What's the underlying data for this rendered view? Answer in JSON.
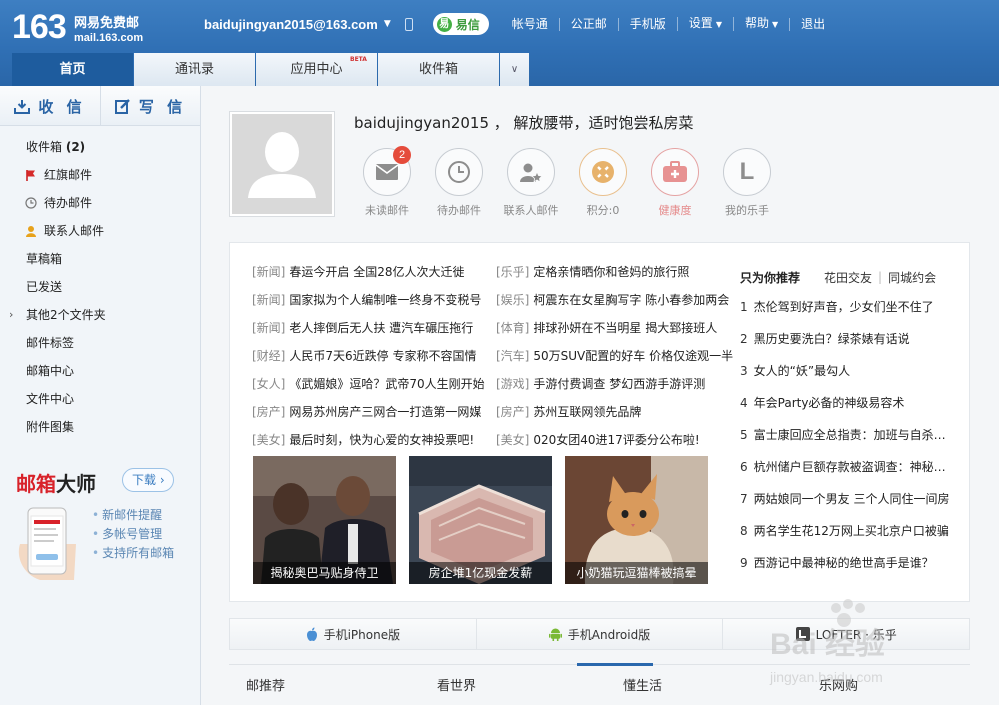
{
  "header": {
    "logo_number": "163",
    "logo_name": "网易免费邮",
    "logo_domain": "mail.163.com",
    "email": "baidujingyan2015@163.com",
    "yixin_label": "易信",
    "links": [
      "帐号通",
      "公正邮",
      "手机版",
      "设置",
      "帮助",
      "退出"
    ]
  },
  "tabs": [
    {
      "label": "首页",
      "active": true
    },
    {
      "label": "通讯录"
    },
    {
      "label": "应用中心",
      "badge": "BETA"
    },
    {
      "label": "收件箱"
    }
  ],
  "sidebar": {
    "receive_label": "收 信",
    "compose_label": "写 信",
    "items": [
      {
        "label": "收件箱",
        "count": "(2)"
      },
      {
        "label": "红旗邮件",
        "icon": "red-flag-icon"
      },
      {
        "label": "待办邮件",
        "icon": "clock-icon"
      },
      {
        "label": "联系人邮件",
        "icon": "contact-icon"
      },
      {
        "label": "草稿箱"
      },
      {
        "label": "已发送"
      },
      {
        "label": "其他2个文件夹",
        "expandable": true
      },
      {
        "label": "邮件标签"
      },
      {
        "label": "邮箱中心"
      },
      {
        "label": "文件中心"
      },
      {
        "label": "附件图集"
      }
    ],
    "promo": {
      "title_red": "邮箱",
      "title_dark": "大师",
      "download_label": "下载",
      "features": [
        "新邮件提醒",
        "多帐号管理",
        "支持所有邮箱"
      ]
    }
  },
  "profile": {
    "greeting": "baidujingyan2015 ，  解放腰带，适时饱尝私房菜",
    "stats": [
      {
        "label": "未读邮件",
        "badge": "2",
        "icon": "envelope-icon"
      },
      {
        "label": "待办邮件",
        "icon": "clock-icon"
      },
      {
        "label": "联系人邮件",
        "icon": "contact-star-icon"
      },
      {
        "label": "积分:0",
        "icon": "points-icon"
      },
      {
        "label": "健康度",
        "icon": "medkit-icon"
      },
      {
        "label": "我的乐手",
        "icon": "letter-l-icon",
        "glyph": "L"
      }
    ]
  },
  "news": [
    [
      {
        "cat": "[新闻]",
        "title": "春运今开启 全国28亿人次大迁徙"
      },
      {
        "cat": "[乐乎]",
        "title": "定格亲情晒你和爸妈的旅行照"
      }
    ],
    [
      {
        "cat": "[新闻]",
        "title": "国家拟为个人编制唯一终身不变税号"
      },
      {
        "cat": "[娱乐]",
        "title": "柯震东在女星胸写字 陈小春参加两会"
      }
    ],
    [
      {
        "cat": "[新闻]",
        "title": "老人摔倒后无人扶 遭汽车碾压拖行"
      },
      {
        "cat": "[体育]",
        "title": "排球孙妍在不当明星 揭大郅接班人"
      }
    ],
    [
      {
        "cat": "[财经]",
        "title": "人民币7天6近跌停 专家称不容国情"
      },
      {
        "cat": "[汽车]",
        "title": "50万SUV配置的好车 价格仅途观一半"
      }
    ],
    [
      {
        "cat": "[女人]",
        "title": "《武媚娘》逗哈？武帝70人生刚开始"
      },
      {
        "cat": "[游戏]",
        "title": "手游付费调查 梦幻西游手游评测"
      }
    ],
    [
      {
        "cat": "[房产]",
        "title": "网易苏州房产三网合一打造第一网媒"
      },
      {
        "cat": "[房产]",
        "title": "苏州互联网领先品牌"
      }
    ],
    [
      {
        "cat": "[美女]",
        "title": "最后时刻，快为心爱的女神投票吧!"
      },
      {
        "cat": "[美女]",
        "title": "020女团40进17评委分公布啦!"
      }
    ]
  ],
  "pictures": [
    {
      "caption": "揭秘奥巴马贴身侍卫"
    },
    {
      "caption": "房企堆1亿现金发薪"
    },
    {
      "caption": "小奶猫玩逗猫棒被搞晕"
    }
  ],
  "recommend": {
    "heading": "只为你推荐",
    "links": [
      "花田交友",
      "同城约会"
    ],
    "items": [
      {
        "n": "1",
        "title": "杰伦驾到好声音，少女们坐不住了"
      },
      {
        "n": "2",
        "title": "黑历史要洗白？绿茶婊有话说"
      },
      {
        "n": "3",
        "title": "女人的“妖”最勾人"
      },
      {
        "n": "4",
        "title": "年会Party必备的神级易容术"
      },
      {
        "n": "5",
        "title": "富士康回应全总指责：加班与自杀无关"
      },
      {
        "n": "6",
        "title": "杭州储户巨额存款被盗调查：神秘人物"
      },
      {
        "n": "7",
        "title": "两姑娘同一个男友 三个人同住一间房"
      },
      {
        "n": "8",
        "title": "两名学生花12万网上买北京户口被骗"
      },
      {
        "n": "9",
        "title": "西游记中最神秘的绝世高手是谁？"
      }
    ]
  },
  "apps": [
    {
      "label": "手机iPhone版",
      "icon": "apple-icon"
    },
    {
      "label": "手机Android版",
      "icon": "android-icon"
    },
    {
      "label": "LOFTER · 乐乎",
      "icon": "lofter-icon"
    }
  ],
  "bottom_tabs": [
    {
      "label": "邮推荐"
    },
    {
      "label": "看世界",
      "active": true
    },
    {
      "label": "懂生活"
    },
    {
      "label": "乐网购"
    }
  ],
  "watermark": {
    "text": "Bai 经验",
    "url": "jingyan.baidu.com"
  },
  "colors": {
    "header": "#2f6fb4",
    "active_tab": "#1e5c9e",
    "badge": "#e54c3c",
    "promo_red": "#d8222a"
  }
}
